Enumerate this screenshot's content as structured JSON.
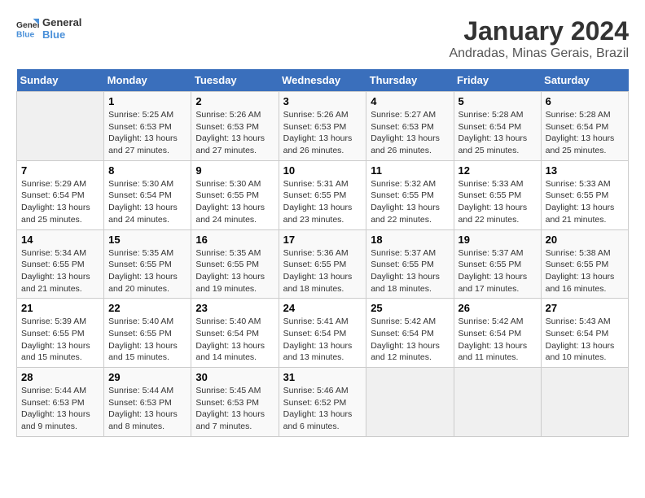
{
  "logo": {
    "text_general": "General",
    "text_blue": "Blue"
  },
  "title": "January 2024",
  "subtitle": "Andradas, Minas Gerais, Brazil",
  "headers": [
    "Sunday",
    "Monday",
    "Tuesday",
    "Wednesday",
    "Thursday",
    "Friday",
    "Saturday"
  ],
  "weeks": [
    [
      {
        "day": "",
        "info": ""
      },
      {
        "day": "1",
        "info": "Sunrise: 5:25 AM\nSunset: 6:53 PM\nDaylight: 13 hours\nand 27 minutes."
      },
      {
        "day": "2",
        "info": "Sunrise: 5:26 AM\nSunset: 6:53 PM\nDaylight: 13 hours\nand 27 minutes."
      },
      {
        "day": "3",
        "info": "Sunrise: 5:26 AM\nSunset: 6:53 PM\nDaylight: 13 hours\nand 26 minutes."
      },
      {
        "day": "4",
        "info": "Sunrise: 5:27 AM\nSunset: 6:53 PM\nDaylight: 13 hours\nand 26 minutes."
      },
      {
        "day": "5",
        "info": "Sunrise: 5:28 AM\nSunset: 6:54 PM\nDaylight: 13 hours\nand 25 minutes."
      },
      {
        "day": "6",
        "info": "Sunrise: 5:28 AM\nSunset: 6:54 PM\nDaylight: 13 hours\nand 25 minutes."
      }
    ],
    [
      {
        "day": "7",
        "info": "Sunrise: 5:29 AM\nSunset: 6:54 PM\nDaylight: 13 hours\nand 25 minutes."
      },
      {
        "day": "8",
        "info": "Sunrise: 5:30 AM\nSunset: 6:54 PM\nDaylight: 13 hours\nand 24 minutes."
      },
      {
        "day": "9",
        "info": "Sunrise: 5:30 AM\nSunset: 6:55 PM\nDaylight: 13 hours\nand 24 minutes."
      },
      {
        "day": "10",
        "info": "Sunrise: 5:31 AM\nSunset: 6:55 PM\nDaylight: 13 hours\nand 23 minutes."
      },
      {
        "day": "11",
        "info": "Sunrise: 5:32 AM\nSunset: 6:55 PM\nDaylight: 13 hours\nand 22 minutes."
      },
      {
        "day": "12",
        "info": "Sunrise: 5:33 AM\nSunset: 6:55 PM\nDaylight: 13 hours\nand 22 minutes."
      },
      {
        "day": "13",
        "info": "Sunrise: 5:33 AM\nSunset: 6:55 PM\nDaylight: 13 hours\nand 21 minutes."
      }
    ],
    [
      {
        "day": "14",
        "info": "Sunrise: 5:34 AM\nSunset: 6:55 PM\nDaylight: 13 hours\nand 21 minutes."
      },
      {
        "day": "15",
        "info": "Sunrise: 5:35 AM\nSunset: 6:55 PM\nDaylight: 13 hours\nand 20 minutes."
      },
      {
        "day": "16",
        "info": "Sunrise: 5:35 AM\nSunset: 6:55 PM\nDaylight: 13 hours\nand 19 minutes."
      },
      {
        "day": "17",
        "info": "Sunrise: 5:36 AM\nSunset: 6:55 PM\nDaylight: 13 hours\nand 18 minutes."
      },
      {
        "day": "18",
        "info": "Sunrise: 5:37 AM\nSunset: 6:55 PM\nDaylight: 13 hours\nand 18 minutes."
      },
      {
        "day": "19",
        "info": "Sunrise: 5:37 AM\nSunset: 6:55 PM\nDaylight: 13 hours\nand 17 minutes."
      },
      {
        "day": "20",
        "info": "Sunrise: 5:38 AM\nSunset: 6:55 PM\nDaylight: 13 hours\nand 16 minutes."
      }
    ],
    [
      {
        "day": "21",
        "info": "Sunrise: 5:39 AM\nSunset: 6:55 PM\nDaylight: 13 hours\nand 15 minutes."
      },
      {
        "day": "22",
        "info": "Sunrise: 5:40 AM\nSunset: 6:55 PM\nDaylight: 13 hours\nand 15 minutes."
      },
      {
        "day": "23",
        "info": "Sunrise: 5:40 AM\nSunset: 6:54 PM\nDaylight: 13 hours\nand 14 minutes."
      },
      {
        "day": "24",
        "info": "Sunrise: 5:41 AM\nSunset: 6:54 PM\nDaylight: 13 hours\nand 13 minutes."
      },
      {
        "day": "25",
        "info": "Sunrise: 5:42 AM\nSunset: 6:54 PM\nDaylight: 13 hours\nand 12 minutes."
      },
      {
        "day": "26",
        "info": "Sunrise: 5:42 AM\nSunset: 6:54 PM\nDaylight: 13 hours\nand 11 minutes."
      },
      {
        "day": "27",
        "info": "Sunrise: 5:43 AM\nSunset: 6:54 PM\nDaylight: 13 hours\nand 10 minutes."
      }
    ],
    [
      {
        "day": "28",
        "info": "Sunrise: 5:44 AM\nSunset: 6:53 PM\nDaylight: 13 hours\nand 9 minutes."
      },
      {
        "day": "29",
        "info": "Sunrise: 5:44 AM\nSunset: 6:53 PM\nDaylight: 13 hours\nand 8 minutes."
      },
      {
        "day": "30",
        "info": "Sunrise: 5:45 AM\nSunset: 6:53 PM\nDaylight: 13 hours\nand 7 minutes."
      },
      {
        "day": "31",
        "info": "Sunrise: 5:46 AM\nSunset: 6:52 PM\nDaylight: 13 hours\nand 6 minutes."
      },
      {
        "day": "",
        "info": ""
      },
      {
        "day": "",
        "info": ""
      },
      {
        "day": "",
        "info": ""
      }
    ]
  ]
}
